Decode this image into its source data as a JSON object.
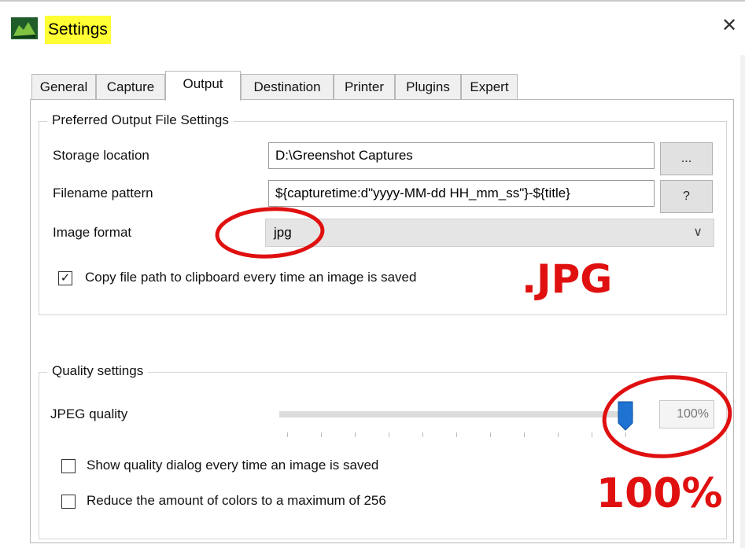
{
  "window": {
    "title": "Settings",
    "close_glyph": "✕",
    "app_icon": "greenshot-icon"
  },
  "tabs": [
    {
      "label": "General",
      "active": false
    },
    {
      "label": "Capture",
      "active": false
    },
    {
      "label": "Output",
      "active": true
    },
    {
      "label": "Destination",
      "active": false
    },
    {
      "label": "Printer",
      "active": false
    },
    {
      "label": "Plugins",
      "active": false
    },
    {
      "label": "Expert",
      "active": false
    }
  ],
  "output_group": {
    "legend": "Preferred Output File Settings",
    "storage_label": "Storage location",
    "storage_value": "D:\\Greenshot Captures",
    "browse_label": "...",
    "pattern_label": "Filename pattern",
    "pattern_value": "${capturetime:d\"yyyy-MM-dd HH_mm_ss\"}-${title}",
    "help_label": "?",
    "format_label": "Image format",
    "format_value": "jpg",
    "copy_path_label": "Copy file path to clipboard every time an image is saved",
    "copy_path_checked": true
  },
  "quality_group": {
    "legend": "Quality settings",
    "jpeg_label": "JPEG quality",
    "jpeg_value_text": "100%",
    "jpeg_level": 100,
    "show_dialog_label": "Show quality dialog every time an image is saved",
    "show_dialog_checked": false,
    "reduce_colors_label": "Reduce the amount of colors to a maximum of 256",
    "reduce_colors_checked": false
  },
  "annotations": {
    "jpg_text": ".JPG",
    "percent_text": "100%",
    "color": "#e01010"
  },
  "colors": {
    "title_highlight": "#ffff33",
    "slider_thumb": "#1e73d2"
  }
}
